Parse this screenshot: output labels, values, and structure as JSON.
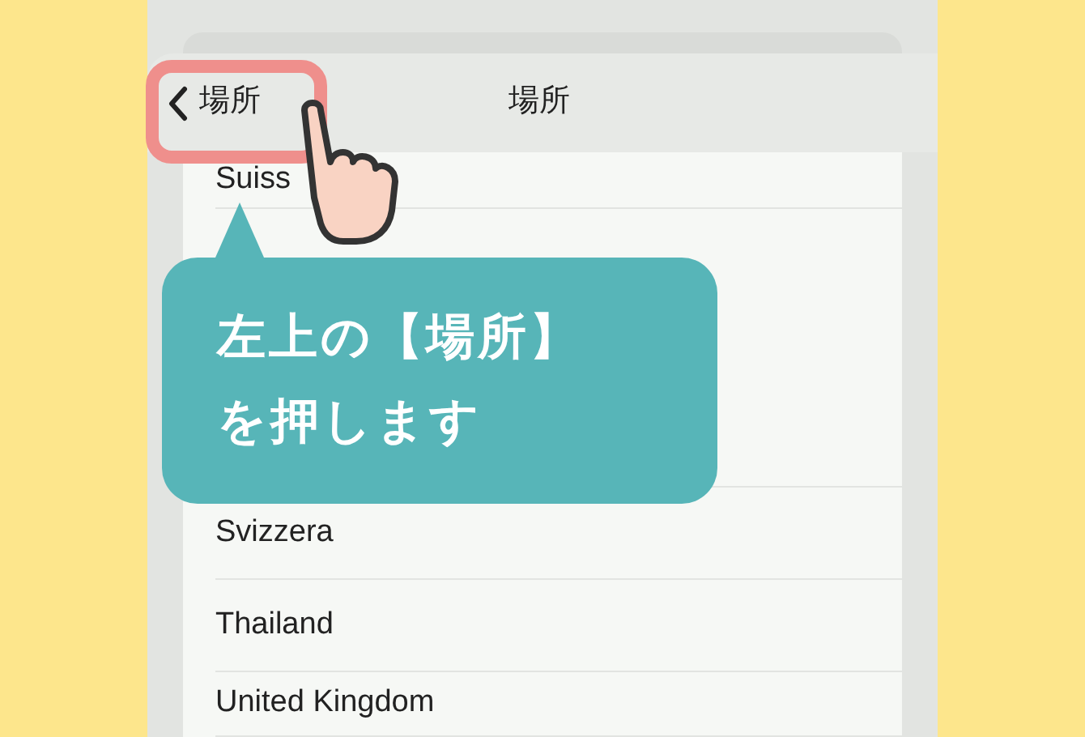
{
  "nav": {
    "back_label": "場所",
    "title": "場所"
  },
  "rows": [
    {
      "kind": "item",
      "label": "Suiss"
    },
    {
      "kind": "blank"
    },
    {
      "kind": "item",
      "label": "Svizzera"
    },
    {
      "kind": "item",
      "label": "Thailand"
    },
    {
      "kind": "item",
      "label": "United Kingdom"
    }
  ],
  "callout": {
    "lines": [
      "左上の【場所】",
      "を押します"
    ]
  }
}
